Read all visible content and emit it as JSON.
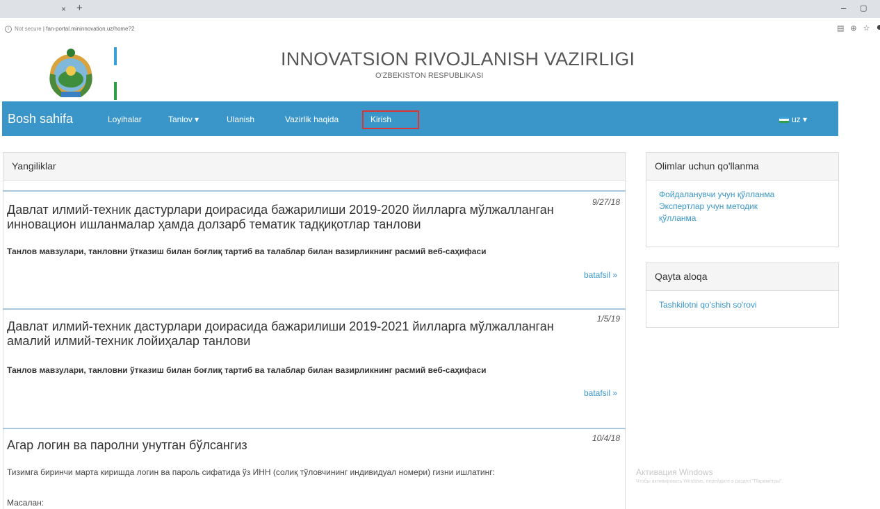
{
  "browser": {
    "tab_close_glyph": "×",
    "new_tab_glyph": "+",
    "minimize_glyph": "–",
    "restore_glyph": "▢",
    "security_label": "Not secure",
    "url": "fan-portal.mininnovation.uz/home?2",
    "icons": [
      "translate-icon",
      "zoom-icon",
      "star-icon",
      "profile-icon"
    ]
  },
  "header": {
    "title": "INNOVATSION RIVOJLANISH VAZIRLIGI",
    "subtitle": "O'ZBEKISTON RESPUBLIKASI"
  },
  "nav": {
    "brand": "Bosh sahifa",
    "items": [
      {
        "label": "Loyihalar"
      },
      {
        "label": "Tanlov ▾"
      },
      {
        "label": "Ulanish"
      },
      {
        "label": "Vazirlik haqida"
      },
      {
        "label": "Kirish"
      }
    ],
    "lang": "uz ▾"
  },
  "news": {
    "heading": "Yangiliklar",
    "items": [
      {
        "title": "Давлат илмий-техник дастурлари доирасида бажарилиши 2019-2020 йилларга мўлжалланган инновацион ишланмалар ҳамда долзарб тематик тадқиқотлар танлови",
        "date": "9/27/18",
        "summary": "Танлов мавзулари, танловни ўтказиш билан боғлиқ тартиб ва талаблар билан вазирликнинг расмий веб-саҳифаси",
        "more": "batafsil »"
      },
      {
        "title": "Давлат илмий-техник дастурлари доирасида бажарилиши 2019-2021 йилларга мўлжалланган амалий илмий-техник лойиҳалар танлови",
        "date": "1/5/19",
        "summary": "Танлов мавзулари, танловни ўтказиш билан боғлиқ тартиб ва талаблар билан вазирликнинг расмий веб-саҳифаси",
        "more": "batafsil »"
      },
      {
        "title": "Агар логин ва паролни унутган бўлсангиз",
        "date": "10/4/18",
        "text": "Тизимга биринчи марта киришда логин ва пароль сифатида ўз ИНН (солиқ тўловчининг индивидуал номери) гизни ишлатинг:",
        "text2": "Масалан:"
      }
    ]
  },
  "sidebar": {
    "guide": {
      "heading": "Olimlar uchun qo'llanma",
      "links": [
        "Фойдаланувчи учун қўлланма",
        "Экспертлар учун методик қўлланма"
      ]
    },
    "feedback": {
      "heading": "Qayta aloqa",
      "links": [
        "Tashkilotni qo'shish so'rovi"
      ]
    }
  },
  "watermark": {
    "title": "Активация Windows",
    "text": "Чтобы активировать Windows, перейдите в раздел \"Параметры\"."
  },
  "colors": {
    "navbar": "#3a96c8",
    "link": "#3a96c8",
    "highlight_box": "#dd3333"
  }
}
